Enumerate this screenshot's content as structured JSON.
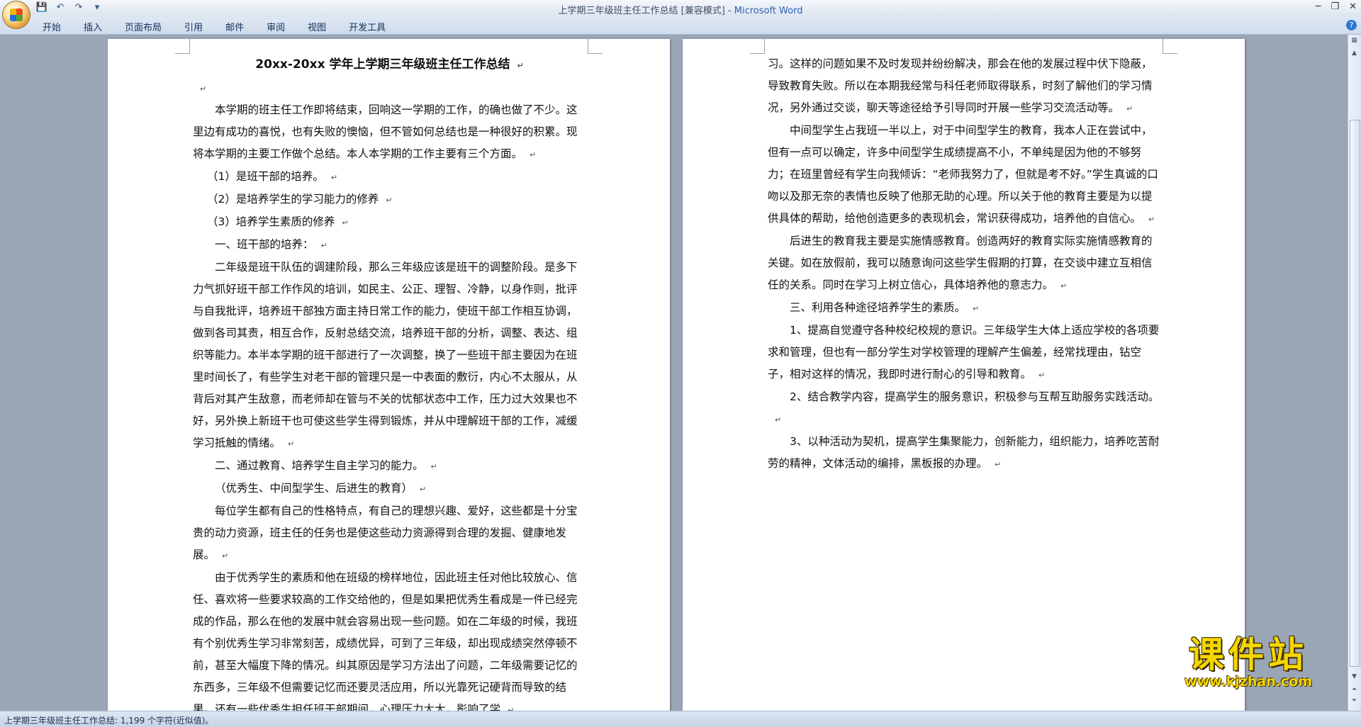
{
  "window": {
    "title_doc": "上学期三年级班主任工作总结 [兼容模式] - ",
    "title_app": "Microsoft Word",
    "quick_access": {
      "save_icon": "save-icon",
      "undo_icon": "undo-icon",
      "redo_icon": "redo-icon",
      "customize_icon": "customize-icon"
    }
  },
  "ribbon": {
    "tabs": [
      "开始",
      "插入",
      "页面布局",
      "引用",
      "邮件",
      "审阅",
      "视图",
      "开发工具"
    ]
  },
  "document": {
    "left_page": [
      {
        "type": "title",
        "text": "20xx-20xx 学年上学期三年级班主任工作总结"
      },
      {
        "type": "blank",
        "text": ""
      },
      {
        "type": "indent",
        "text": "本学期的班主任工作即将结束，回响这一学期的工作，的确也做了不少。这里边有成功的喜悦，也有失败的懊恼，但不管如何总结也是一种很好的积累。现将本学期的主要工作做个总结。本人本学期的工作主要有三个方面。"
      },
      {
        "type": "list",
        "text": "（1）是班干部的培养。"
      },
      {
        "type": "list",
        "text": "（2）是培养学生的学习能力的修养"
      },
      {
        "type": "list",
        "text": "（3）培养学生素质的修养"
      },
      {
        "type": "indent",
        "text": "一、班干部的培养："
      },
      {
        "type": "indent",
        "text": "二年级是班干队伍的调建阶段，那么三年级应该是班干的调整阶段。是多下力气抓好班干部工作作风的培训，如民主、公正、理智、冷静，以身作则，批评与自我批评，培养班干部独方面主持日常工作的能力，使班干部工作相互协调，做到各司其责，相互合作，反射总结交流，培养班干部的分析，调整、表达、组织等能力。本半本学期的班干部进行了一次调整，换了一些班干部主要因为在班里时间长了，有些学生对老干部的管理只是一中表面的敷衍，内心不太服从，从背后对其产生敌意，而老师却在管与不关的忧郁状态中工作，压力过大效果也不好，另外换上新班干也可使这些学生得到锻炼，并从中理解班干部的工作，减缓学习抵触的情绪。"
      },
      {
        "type": "indent",
        "text": "二、通过教育、培养学生自主学习的能力。"
      },
      {
        "type": "indent",
        "text": "（优秀生、中间型学生、后进生的教育）"
      },
      {
        "type": "indent",
        "text": "每位学生都有自己的性格特点，有自己的理想兴趣、爱好，这些都是十分宝贵的动力资源，班主任的任务也是使这些动力资源得到合理的发掘、健康地发展。"
      },
      {
        "type": "indent",
        "text": "由于优秀学生的素质和他在班级的榜样地位，因此班主任对他比较放心、信任、喜欢将一些要求较高的工作交给他的，但是如果把优秀生看成是一件已经完成的作品，那么在他的发展中就会容易出现一些问题。如在二年级的时候，我班有个别优秀生学习非常刻苦，成绩优异，可到了三年级，却出现成绩突然停顿不前，甚至大幅度下降的情况。纠其原因是学习方法出了问题，二年级需要记忆的东西多，三年级不但需要记忆而还要灵活应用，所以光靠死记硬背而导致的结果。还有一些优秀生担任班干部期间，心理压力太大，影响了学"
      }
    ],
    "right_page": [
      {
        "type": "plain",
        "text": "习。这样的问题如果不及时发现并纷纷解决，那会在他的发展过程中伏下隐蔽，导致教育失败。所以在本期我经常与科任老师取得联系，时刻了解他们的学习情况，另外通过交谈，聊天等途径给予引导同时开展一些学习交流活动等。"
      },
      {
        "type": "indent",
        "text": "中间型学生占我班一半以上，对于中间型学生的教育，我本人正在尝试中，但有一点可以确定，许多中间型学生成绩提高不小，不单纯是因为他的不够努力；在班里曾经有学生向我倾诉：“老师我努力了，但就是考不好。”学生真诚的口吻以及那无奈的表情也反映了他那无助的心理。所以关于他的教育主要是为以提供具体的帮助，给他创造更多的表现机会，常识获得成功，培养他的自信心。"
      },
      {
        "type": "indent",
        "text": "后进生的教育我主要是实施情感教育。创造两好的教育实际实施情感教育的关键。如在放假前，我可以随意询问这些学生假期的打算，在交谈中建立互相信任的关系。同时在学习上树立信心，具体培养他的意志力。"
      },
      {
        "type": "indent",
        "text": "三、利用各种途径培养学生的素质。"
      },
      {
        "type": "indent",
        "text": "1、提高自觉遵守各种校纪校规的意识。三年级学生大体上适应学校的各项要求和管理，但也有一部分学生对学校管理的理解产生偏差，经常找理由，钻空子，相对这样的情况，我即时进行耐心的引导和教育。"
      },
      {
        "type": "indent",
        "text": "2、结合教学内容，提高学生的服务意识，积极参与互帮互助服务实践活动。"
      },
      {
        "type": "indent",
        "text": "3、以种活动为契机，提高学生集聚能力，创新能力，组织能力，培养吃苦耐劳的精神，文体活动的编排，黑板报的办理。"
      }
    ]
  },
  "statusbar": {
    "stats": "上学期三年级班主任工作总结: 1,199 个字符(近似值)。"
  },
  "watermark": {
    "text": "课件站",
    "url": "www.kjzhan.com"
  }
}
